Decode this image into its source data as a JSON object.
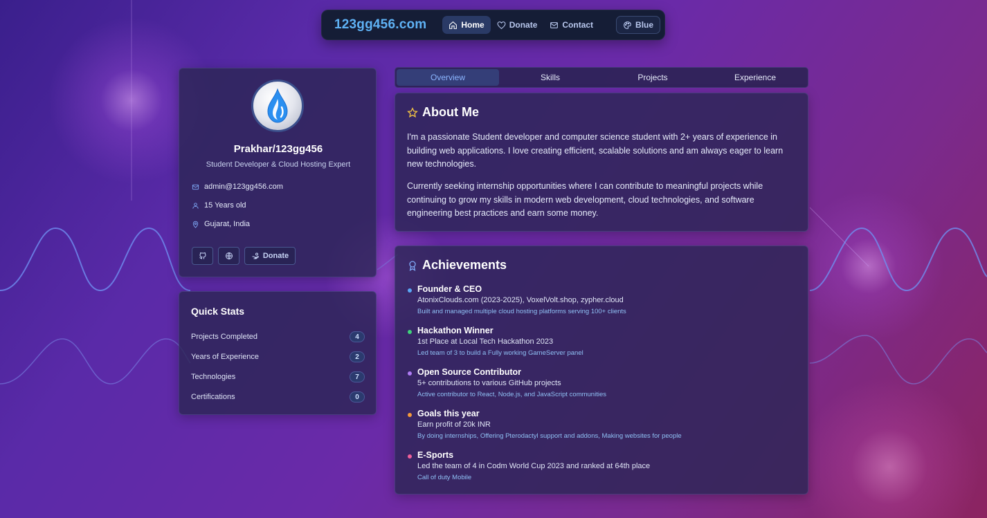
{
  "nav": {
    "brand": "123gg456.com",
    "items": [
      {
        "label": "Home",
        "icon": "home-icon",
        "active": true
      },
      {
        "label": "Donate",
        "icon": "heart-icon"
      },
      {
        "label": "Contact",
        "icon": "mail-icon"
      }
    ],
    "theme": {
      "label": "Blue",
      "icon": "palette-icon"
    }
  },
  "profile": {
    "avatar_icon": "water-drop-icon",
    "name": "Prakhar/123gg456",
    "subtitle": "Student Developer & Cloud Hosting Expert",
    "email": "admin@123gg456.com",
    "age": "15 Years old",
    "location": "Gujarat, India",
    "buttons": {
      "github_icon": "github-icon",
      "website_icon": "globe-icon",
      "donate_label": "Donate",
      "donate_icon": "hand-coins-icon"
    }
  },
  "stats": {
    "title": "Quick Stats",
    "rows": [
      {
        "label": "Projects Completed",
        "value": "4"
      },
      {
        "label": "Years of Experience",
        "value": "2"
      },
      {
        "label": "Technologies",
        "value": "7"
      },
      {
        "label": "Certifications",
        "value": "0"
      }
    ]
  },
  "tabs": [
    {
      "label": "Overview",
      "active": true
    },
    {
      "label": "Skills"
    },
    {
      "label": "Projects"
    },
    {
      "label": "Experience"
    }
  ],
  "about": {
    "title": "About Me",
    "icon": "star-icon",
    "p1": "I'm a passionate Student developer and computer science student with 2+ years of experience in building web applications. I love creating efficient, scalable solutions and am always eager to learn new technologies.",
    "p2": "Currently seeking internship opportunities where I can contribute to meaningful projects while continuing to grow my skills in modern web development, cloud technologies, and software engineering best practices and earn some money."
  },
  "achievements": {
    "title": "Achievements",
    "icon": "award-icon",
    "items": [
      {
        "title": "Founder & CEO",
        "desc": "AtonixClouds.com (2023-2025), VoxelVolt.shop, zypher.cloud",
        "note": "Built and managed multiple cloud hosting platforms serving 100+ clients",
        "color": "#5aa7f5"
      },
      {
        "title": "Hackathon Winner",
        "desc": "1st Place at Local Tech Hackathon 2023",
        "note": "Led team of 3 to build a Fully working GameServer panel",
        "color": "#3fd27a"
      },
      {
        "title": "Open Source Contributor",
        "desc": "5+ contributions to various GitHub projects",
        "note": "Active contributor to React, Node.js, and JavaScript communities",
        "color": "#b07cf5"
      },
      {
        "title": "Goals this year",
        "desc": "Earn profit of 20k INR",
        "note": "By doing internships, Offering Pterodactyl support and addons, Making websites for people",
        "color": "#f59a3a"
      },
      {
        "title": "E-Sports",
        "desc": "Led the team of 4 in Codm World Cup 2023 and ranked at 64th place",
        "note": "Call of duty Mobile",
        "color": "#f0609a"
      }
    ]
  }
}
